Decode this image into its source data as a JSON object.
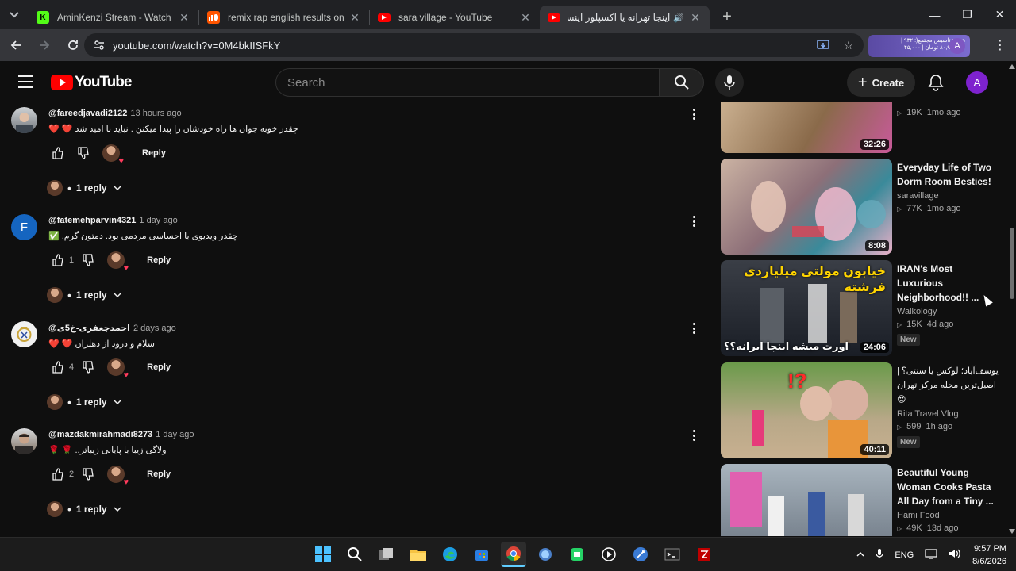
{
  "browser": {
    "tabs": [
      {
        "title": "AminKenzi Stream - Watch Live",
        "favicon": "kick-icon",
        "fav_color": "#53fc18",
        "fav_letter": "K"
      },
      {
        "title": "remix rap english results on So",
        "favicon": "soundcloud-icon",
        "fav_color": "#ff5500",
        "fav_letter": ""
      },
      {
        "title": "sara village - YouTube",
        "favicon": "youtube-icon",
        "fav_color": "#ff0000",
        "fav_letter": ""
      },
      {
        "title": "اینجا تهرانه یا اکسپلور اینستاگر",
        "favicon": "youtube-icon",
        "fav_color": "#ff0000",
        "fav_letter": "",
        "active": true
      }
    ],
    "url": "youtube.com/watch?v=0M4bkIISFkY",
    "extension_text": "هدف: تاسیس مجتمع(: ۹۳۲ | ۸۰,۹۷۰۰۰۰ تومان | ۴۵,۰۰۰",
    "profile_letter": "A"
  },
  "youtube": {
    "logo_text": "YouTube",
    "search_placeholder": "Search",
    "create_label": "Create",
    "avatar_letter": "A"
  },
  "comments": [
    {
      "handle": "@fareedjavadi2122",
      "time": "13 hours ago",
      "text": "چقدر خوبه جوان ها راه خودشان را پیدا میکنن . نباید نا امید شد ❤️ ❤️",
      "likes": "",
      "reply_label": "Reply",
      "replies_label": "1 reply",
      "avatar_letter": "",
      "avatar_color": "#8a8f94"
    },
    {
      "handle": "@fatemehparvin4321",
      "time": "1 day ago",
      "text": "چقدر ویدیوی با احساسی مردمی بود. دمتون گرم. ✅",
      "likes": "1",
      "reply_label": "Reply",
      "replies_label": "1 reply",
      "avatar_letter": "F",
      "avatar_color": "#1565c0"
    },
    {
      "handle": "@احمدجعفری-خ5ی",
      "time": "2 days ago",
      "text": "سلام و درود از دهلران ❤️ ❤️",
      "likes": "4",
      "reply_label": "Reply",
      "replies_label": "1 reply",
      "avatar_letter": "",
      "avatar_color": "#f1f1f1"
    },
    {
      "handle": "@mazdakmirahmadi8273",
      "time": "1 day ago",
      "text": "ولاگی زیبا با پایانی زیباتر.. 🌹 🌹",
      "likes": "2",
      "reply_label": "Reply",
      "replies_label": "1 reply",
      "avatar_letter": "",
      "avatar_color": "#5d4a3a"
    }
  ],
  "sidebar": [
    {
      "title": "",
      "channel": "",
      "views": "19K",
      "age": "1mo ago",
      "duration": "32:26",
      "is_new": false,
      "thumb_colors": [
        "#c9a27a",
        "#7a5a3a"
      ]
    },
    {
      "title": "Everyday Life of Two Dorm Room Besties!",
      "channel": "saravillage",
      "views": "77K",
      "age": "1mo ago",
      "duration": "8:08",
      "is_new": false,
      "thumb_colors": [
        "#b89a88",
        "#6e5a66"
      ]
    },
    {
      "title": "IRAN's Most Luxurious Neighborhood!! ...",
      "channel": "Walkology",
      "views": "15K",
      "age": "4d ago",
      "duration": "24:06",
      "is_new": true,
      "new_label": "New",
      "thumb_colors": [
        "#4a4a52",
        "#1e2a3a"
      ],
      "overlay_top": "خیابون مولتی میلیاردی فرشته",
      "overlay_bottom": "اورت میشه اینجا ایرانه؟؟"
    },
    {
      "title": "یوسف‌آباد؛ لوکس یا سنتی؟ | اصیل‌ترین محله مرکز تهران 😍",
      "channel": "Rita Travel Vlog",
      "views": "599",
      "age": "1h ago",
      "duration": "40:11",
      "is_new": true,
      "new_label": "New",
      "thumb_colors": [
        "#6f9a52",
        "#c4a37a"
      ],
      "overlay_top": "!?"
    },
    {
      "title": "Beautiful Young Woman Cooks Pasta All Day from a Tiny ...",
      "channel": "Hami Food",
      "views": "49K",
      "age": "13d ago",
      "duration": "",
      "is_new": false,
      "thumb_colors": [
        "#9aa5b0",
        "#d36aa6"
      ]
    }
  ],
  "taskbar": {
    "language": "ENG",
    "time": "9:57 PM",
    "date": "8/6/2026"
  },
  "colors": {
    "background": "#0f0f0f",
    "youtube_red": "#ff0000",
    "text_primary": "#f1f1f1",
    "text_secondary": "#aaaaaa"
  }
}
